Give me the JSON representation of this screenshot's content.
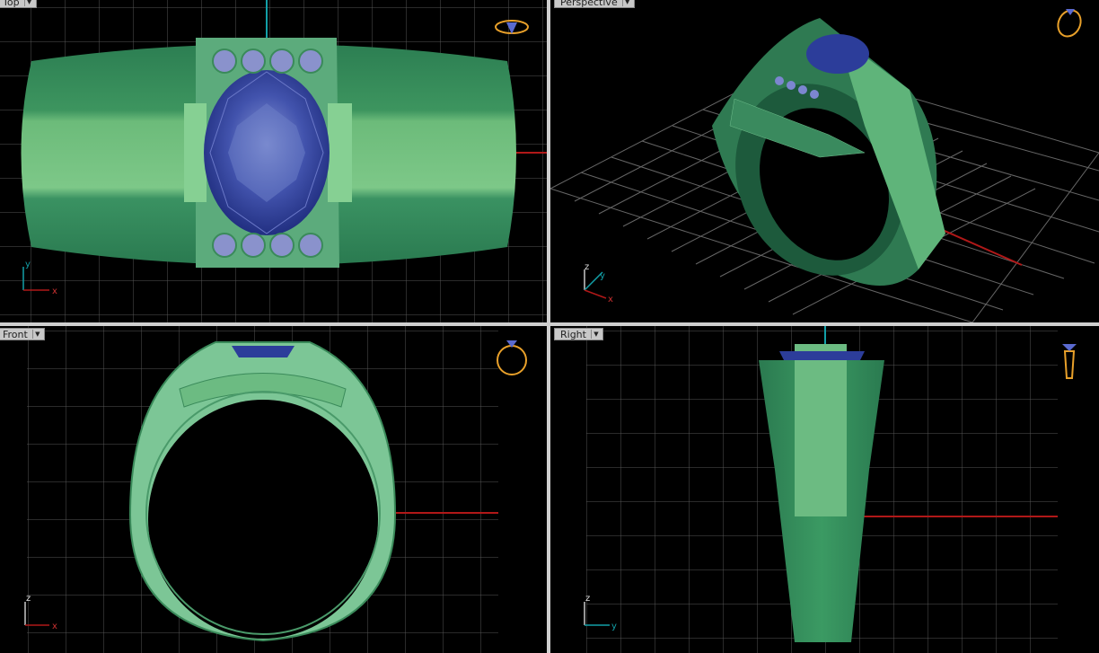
{
  "viewports": {
    "top": {
      "label": "Top",
      "axis_x": "x",
      "axis_y": "y"
    },
    "perspective": {
      "label": "Perspective",
      "axis_x": "x",
      "axis_y": "y",
      "axis_z": "z"
    },
    "front": {
      "label": "Front",
      "axis_x": "x",
      "axis_z": "z"
    },
    "right": {
      "label": "Right",
      "axis_y": "y",
      "axis_z": "z"
    }
  },
  "icons": {
    "top": "ring-top-view-icon",
    "perspective": "ring-perspective-icon",
    "front": "ring-front-view-icon",
    "right": "ring-side-view-icon"
  },
  "colors": {
    "background": "#000000",
    "grid": "#5a5a5a",
    "x_axis": "#b01818",
    "y_axis": "#12a0a8",
    "band_green": "#3f9b6a",
    "band_light": "#82cf92",
    "gem_blue": "#2f3f9a",
    "accent_gold": "#e8a02a"
  }
}
